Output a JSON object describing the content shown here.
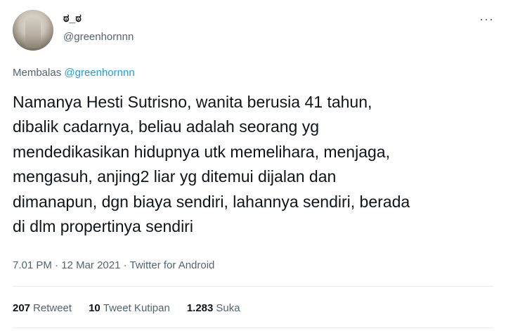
{
  "author": {
    "display_name": "ಠ_ಠ",
    "handle": "@greenhornnn"
  },
  "more_icon": "more-horizontal-icon",
  "reply": {
    "prefix": "Membalas",
    "to": "@greenhornnn"
  },
  "tweet_text": "Namanya Hesti Sutrisno, wanita berusia 41 tahun,\ndibalik cadarnya, beliau adalah seorang yg\nmendedikasikan hidupnya utk memelihara, menjaga,\nmengasuh, anjing2 liar yg ditemui dijalan dan\ndimanapun, dgn biaya sendiri, lahannya sendiri, berada\ndi dlm propertinya sendiri",
  "meta": {
    "time": "7.01 PM",
    "date": "12 Mar 2021",
    "source": "Twitter for Android",
    "separator": " · "
  },
  "stats": {
    "retweets": {
      "count": "207",
      "label": "Retweet"
    },
    "quotes": {
      "count": "10",
      "label": "Tweet Kutipan"
    },
    "likes": {
      "count": "1.283",
      "label": "Suka"
    }
  },
  "colors": {
    "link": "#1d9bf0",
    "secondary_text": "#536471",
    "primary_text": "#0f1419",
    "divider": "#e6ecf0"
  }
}
